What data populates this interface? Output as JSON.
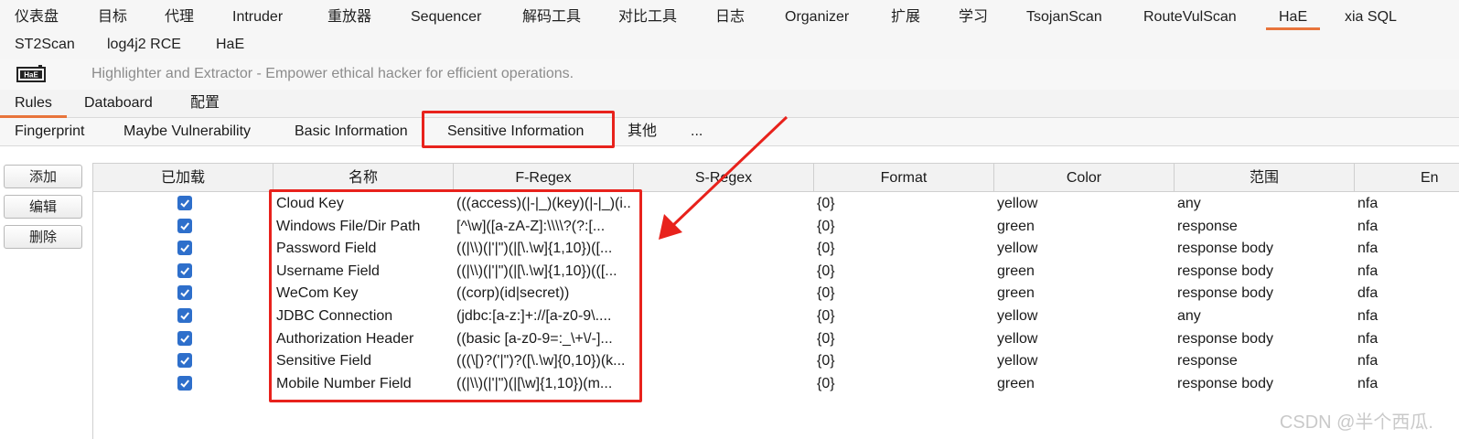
{
  "burp_tabs_row1": [
    "仪表盘",
    "目标",
    "代理",
    "Intruder",
    "重放器",
    "Sequencer",
    "解码工具",
    "对比工具",
    "日志",
    "Organizer",
    "扩展",
    "学习",
    "TsojanScan",
    "RouteVulScan",
    "HaE",
    "xia SQL"
  ],
  "burp_tabs_row2": [
    "ST2Scan",
    "log4j2 RCE",
    "HaE"
  ],
  "active_burp_tab": "HaE",
  "hae": {
    "logo_text": "HaE",
    "description": "Highlighter and Extractor - Empower ethical hacker for efficient operations."
  },
  "sub_tabs": [
    "Rules",
    "Databoard",
    "配置"
  ],
  "active_sub_tab": "Rules",
  "category_tabs": [
    "Fingerprint",
    "Maybe Vulnerability",
    "Basic Information",
    "Sensitive Information",
    "其他",
    "..."
  ],
  "active_category_tab": "Sensitive Information",
  "side_buttons": [
    "添加",
    "编辑",
    "删除"
  ],
  "table": {
    "columns": [
      "已加载",
      "名称",
      "F-Regex",
      "S-Regex",
      "Format",
      "Color",
      "范围",
      "En"
    ],
    "rows": [
      {
        "loaded": true,
        "name": "Cloud Key",
        "f_regex": "(((access)(|-|_)(key)(|-|_)(i...",
        "s_regex": "",
        "format": "{0}",
        "color": "yellow",
        "scope": "any",
        "engine": "nfa"
      },
      {
        "loaded": true,
        "name": "Windows File/Dir Path",
        "f_regex": "[^\\w]([a-zA-Z]:\\\\\\\\?(?:[...",
        "s_regex": "",
        "format": "{0}",
        "color": "green",
        "scope": "response",
        "engine": "nfa"
      },
      {
        "loaded": true,
        "name": "Password Field",
        "f_regex": "((|\\\\)(|'|\")(|[\\.\\w]{1,10})([...",
        "s_regex": "",
        "format": "{0}",
        "color": "yellow",
        "scope": "response body",
        "engine": "nfa"
      },
      {
        "loaded": true,
        "name": "Username Field",
        "f_regex": "((|\\\\)(|'|\")(|[\\.\\w]{1,10})(([...",
        "s_regex": "",
        "format": "{0}",
        "color": "green",
        "scope": "response body",
        "engine": "nfa"
      },
      {
        "loaded": true,
        "name": "WeCom Key",
        "f_regex": "((corp)(id|secret))",
        "s_regex": "",
        "format": "{0}",
        "color": "green",
        "scope": "response body",
        "engine": "dfa"
      },
      {
        "loaded": true,
        "name": "JDBC Connection",
        "f_regex": "(jdbc:[a-z:]+://[a-z0-9\\....",
        "s_regex": "",
        "format": "{0}",
        "color": "yellow",
        "scope": "any",
        "engine": "nfa"
      },
      {
        "loaded": true,
        "name": "Authorization Header",
        "f_regex": "((basic [a-z0-9=:_\\+\\/-]...",
        "s_regex": "",
        "format": "{0}",
        "color": "yellow",
        "scope": "response body",
        "engine": "nfa"
      },
      {
        "loaded": true,
        "name": "Sensitive Field",
        "f_regex": "(((\\[)?('|\")?([\\.\\w]{0,10})(k...",
        "s_regex": "",
        "format": "{0}",
        "color": "yellow",
        "scope": "response",
        "engine": "nfa"
      },
      {
        "loaded": true,
        "name": "Mobile Number Field",
        "f_regex": "((|\\\\)(|'|\")(|[\\w]{1,10})(m...",
        "s_regex": "",
        "format": "{0}",
        "color": "green",
        "scope": "response body",
        "engine": "nfa"
      }
    ]
  },
  "watermark": "CSDN @半个西瓜.",
  "colors": {
    "accent": "#e8743b",
    "highlight_box": "#e8221c",
    "checkbox": "#2e6fcb"
  }
}
